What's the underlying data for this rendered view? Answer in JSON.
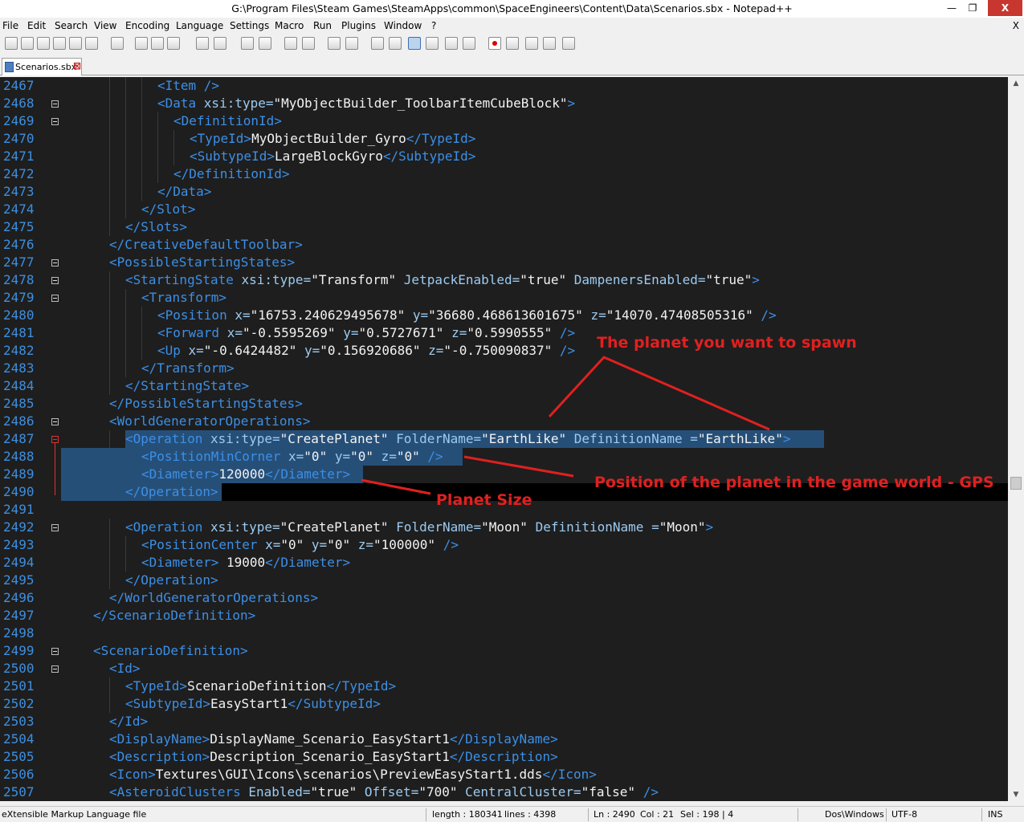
{
  "window": {
    "title": "G:\\Program Files\\Steam Games\\SteamApps\\common\\SpaceEngineers\\Content\\Data\\Scenarios.sbx - Notepad++",
    "min_glyph": "—",
    "max_glyph": "❐",
    "close_glyph": "X"
  },
  "menu": {
    "items": [
      "File",
      "Edit",
      "Search",
      "View",
      "Encoding",
      "Language",
      "Settings",
      "Macro",
      "Run",
      "Plugins",
      "Window",
      "?"
    ],
    "close_glyph": "X"
  },
  "toolbar": {
    "icons": [
      "new-file-icon",
      "open-file-icon",
      "save-icon",
      "save-all-icon",
      "close-icon",
      "close-all-icon",
      "print-icon",
      "cut-icon",
      "copy-icon",
      "paste-icon",
      "undo-icon",
      "redo-icon",
      "find-icon",
      "replace-icon",
      "zoom-in-icon",
      "zoom-out-icon",
      "sync-vertical-icon",
      "sync-horizontal-icon",
      "word-wrap-icon",
      "show-all-chars-icon",
      "indent-guide-icon",
      "user-language-icon",
      "doc-map-icon",
      "function-list-icon",
      "record-macro-icon",
      "stop-macro-icon",
      "play-macro-icon",
      "run-macro-multiple-icon",
      "save-macro-icon"
    ]
  },
  "tab": {
    "label": "Scenarios.sbx",
    "close_glyph": "⊠"
  },
  "editor": {
    "selection_color": "#264f78",
    "line_number_color": "#3d8fe0",
    "lines": [
      {
        "n": "2467",
        "fold": "",
        "indent": 4,
        "tokens": [
          [
            "tg",
            "<Item "
          ],
          [
            "pu",
            "/>"
          ]
        ]
      },
      {
        "n": "2468",
        "fold": "box",
        "indent": 4,
        "tokens": [
          [
            "tg",
            "<Data "
          ],
          [
            "an",
            "xsi:type="
          ],
          [
            "av",
            "\"MyObjectBuilder_ToolbarItemCubeBlock\""
          ],
          [
            "tg",
            ">"
          ]
        ]
      },
      {
        "n": "2469",
        "fold": "box",
        "indent": 5,
        "tokens": [
          [
            "tg",
            "<DefinitionId>"
          ]
        ]
      },
      {
        "n": "2470",
        "fold": "",
        "indent": 6,
        "tokens": [
          [
            "tg",
            "<TypeId>"
          ],
          [
            "tx",
            "MyObjectBuilder_Gyro"
          ],
          [
            "tg",
            "</TypeId>"
          ]
        ]
      },
      {
        "n": "2471",
        "fold": "",
        "indent": 6,
        "tokens": [
          [
            "tg",
            "<SubtypeId>"
          ],
          [
            "tx",
            "LargeBlockGyro"
          ],
          [
            "tg",
            "</SubtypeId>"
          ]
        ]
      },
      {
        "n": "2472",
        "fold": "",
        "indent": 5,
        "tokens": [
          [
            "tg",
            "</DefinitionId>"
          ]
        ]
      },
      {
        "n": "2473",
        "fold": "",
        "indent": 4,
        "tokens": [
          [
            "tg",
            "</Data>"
          ]
        ]
      },
      {
        "n": "2474",
        "fold": "",
        "indent": 3,
        "tokens": [
          [
            "tg",
            "</Slot>"
          ]
        ]
      },
      {
        "n": "2475",
        "fold": "",
        "indent": 2,
        "tokens": [
          [
            "tg",
            "</Slots>"
          ]
        ]
      },
      {
        "n": "2476",
        "fold": "",
        "indent": 1,
        "tokens": [
          [
            "tg",
            "</CreativeDefaultToolbar>"
          ]
        ]
      },
      {
        "n": "2477",
        "fold": "box",
        "indent": 1,
        "tokens": [
          [
            "tg",
            "<PossibleStartingStates>"
          ]
        ]
      },
      {
        "n": "2478",
        "fold": "box",
        "indent": 2,
        "tokens": [
          [
            "tg",
            "<StartingState "
          ],
          [
            "an",
            "xsi:type="
          ],
          [
            "av",
            "\"Transform\" "
          ],
          [
            "an",
            "JetpackEnabled="
          ],
          [
            "av",
            "\"true\" "
          ],
          [
            "an",
            "DampenersEnabled="
          ],
          [
            "av",
            "\"true\""
          ],
          [
            "tg",
            ">"
          ]
        ]
      },
      {
        "n": "2479",
        "fold": "box",
        "indent": 3,
        "tokens": [
          [
            "tg",
            "<Transform>"
          ]
        ]
      },
      {
        "n": "2480",
        "fold": "",
        "indent": 4,
        "tokens": [
          [
            "tg",
            "<Position "
          ],
          [
            "an",
            "x="
          ],
          [
            "av",
            "\"16753.240629495678\" "
          ],
          [
            "an",
            "y="
          ],
          [
            "av",
            "\"36680.468613601675\" "
          ],
          [
            "an",
            "z="
          ],
          [
            "av",
            "\"14070.47408505316\" "
          ],
          [
            "pu",
            "/>"
          ]
        ]
      },
      {
        "n": "2481",
        "fold": "",
        "indent": 4,
        "tokens": [
          [
            "tg",
            "<Forward "
          ],
          [
            "an",
            "x="
          ],
          [
            "av",
            "\"-0.5595269\" "
          ],
          [
            "an",
            "y="
          ],
          [
            "av",
            "\"0.5727671\" "
          ],
          [
            "an",
            "z="
          ],
          [
            "av",
            "\"0.5990555\" "
          ],
          [
            "pu",
            "/>"
          ]
        ]
      },
      {
        "n": "2482",
        "fold": "",
        "indent": 4,
        "tokens": [
          [
            "tg",
            "<Up "
          ],
          [
            "an",
            "x="
          ],
          [
            "av",
            "\"-0.6424482\" "
          ],
          [
            "an",
            "y="
          ],
          [
            "av",
            "\"0.156920686\" "
          ],
          [
            "an",
            "z="
          ],
          [
            "av",
            "\"-0.750090837\" "
          ],
          [
            "pu",
            "/>"
          ]
        ]
      },
      {
        "n": "2483",
        "fold": "",
        "indent": 3,
        "tokens": [
          [
            "tg",
            "</Transform>"
          ]
        ]
      },
      {
        "n": "2484",
        "fold": "",
        "indent": 2,
        "tokens": [
          [
            "tg",
            "</StartingState>"
          ]
        ]
      },
      {
        "n": "2485",
        "fold": "",
        "indent": 1,
        "tokens": [
          [
            "tg",
            "</PossibleStartingStates>"
          ]
        ]
      },
      {
        "n": "2486",
        "fold": "box",
        "indent": 1,
        "tokens": [
          [
            "tg",
            "<WorldGeneratorOperations>"
          ]
        ]
      },
      {
        "n": "2487",
        "fold": "red",
        "indent": 2,
        "tokens": [
          [
            "tg",
            "<Operation "
          ],
          [
            "an",
            "xsi:type="
          ],
          [
            "av",
            "\"CreatePlanet\" "
          ],
          [
            "an",
            "FolderName="
          ],
          [
            "av",
            "\"EarthLike\" "
          ],
          [
            "an",
            "DefinitionName ="
          ],
          [
            "av",
            "\"EarthLike\""
          ],
          [
            "tg",
            ">"
          ]
        ]
      },
      {
        "n": "2488",
        "fold": "",
        "indent": 3,
        "tokens": [
          [
            "tg",
            "<PositionMinCorner "
          ],
          [
            "an",
            "x="
          ],
          [
            "av",
            "\"0\" "
          ],
          [
            "an",
            "y="
          ],
          [
            "av",
            "\"0\" "
          ],
          [
            "an",
            "z="
          ],
          [
            "av",
            "\"0\" "
          ],
          [
            "pu",
            "/>"
          ]
        ]
      },
      {
        "n": "2489",
        "fold": "",
        "indent": 3,
        "tokens": [
          [
            "tg",
            "<Diameter>"
          ],
          [
            "tx",
            "120000"
          ],
          [
            "tg",
            "</Diameter>"
          ]
        ]
      },
      {
        "n": "2490",
        "fold": "",
        "indent": 2,
        "tokens": [
          [
            "tg",
            "</Operation>"
          ]
        ]
      },
      {
        "n": "2491",
        "fold": "",
        "indent": 0,
        "tokens": []
      },
      {
        "n": "2492",
        "fold": "box",
        "indent": 2,
        "tokens": [
          [
            "tg",
            "<Operation "
          ],
          [
            "an",
            "xsi:type="
          ],
          [
            "av",
            "\"CreatePlanet\" "
          ],
          [
            "an",
            "FolderName="
          ],
          [
            "av",
            "\"Moon\" "
          ],
          [
            "an",
            "DefinitionName ="
          ],
          [
            "av",
            "\"Moon\""
          ],
          [
            "tg",
            ">"
          ]
        ]
      },
      {
        "n": "2493",
        "fold": "",
        "indent": 3,
        "tokens": [
          [
            "tg",
            "<PositionCenter "
          ],
          [
            "an",
            "x="
          ],
          [
            "av",
            "\"0\" "
          ],
          [
            "an",
            "y="
          ],
          [
            "av",
            "\"0\" "
          ],
          [
            "an",
            "z="
          ],
          [
            "av",
            "\"100000\" "
          ],
          [
            "pu",
            "/>"
          ]
        ]
      },
      {
        "n": "2494",
        "fold": "",
        "indent": 3,
        "tokens": [
          [
            "tg",
            "<Diameter> "
          ],
          [
            "tx",
            "19000"
          ],
          [
            "tg",
            "</Diameter>"
          ]
        ]
      },
      {
        "n": "2495",
        "fold": "",
        "indent": 2,
        "tokens": [
          [
            "tg",
            "</Operation>"
          ]
        ]
      },
      {
        "n": "2496",
        "fold": "",
        "indent": 1,
        "tokens": [
          [
            "tg",
            "</WorldGeneratorOperations>"
          ]
        ]
      },
      {
        "n": "2497",
        "fold": "",
        "indent": 0,
        "tokens": [
          [
            "tg",
            "</ScenarioDefinition>"
          ]
        ]
      },
      {
        "n": "2498",
        "fold": "",
        "indent": 0,
        "tokens": []
      },
      {
        "n": "2499",
        "fold": "box",
        "indent": 0,
        "tokens": [
          [
            "tg",
            "<ScenarioDefinition>"
          ]
        ]
      },
      {
        "n": "2500",
        "fold": "box",
        "indent": 1,
        "tokens": [
          [
            "tg",
            "<Id>"
          ]
        ]
      },
      {
        "n": "2501",
        "fold": "",
        "indent": 2,
        "tokens": [
          [
            "tg",
            "<TypeId>"
          ],
          [
            "tx",
            "ScenarioDefinition"
          ],
          [
            "tg",
            "</TypeId>"
          ]
        ]
      },
      {
        "n": "2502",
        "fold": "",
        "indent": 2,
        "tokens": [
          [
            "tg",
            "<SubtypeId>"
          ],
          [
            "tx",
            "EasyStart1"
          ],
          [
            "tg",
            "</SubtypeId>"
          ]
        ]
      },
      {
        "n": "2503",
        "fold": "",
        "indent": 1,
        "tokens": [
          [
            "tg",
            "</Id>"
          ]
        ]
      },
      {
        "n": "2504",
        "fold": "",
        "indent": 1,
        "tokens": [
          [
            "tg",
            "<DisplayName>"
          ],
          [
            "tx",
            "DisplayName_Scenario_EasyStart1"
          ],
          [
            "tg",
            "</DisplayName>"
          ]
        ]
      },
      {
        "n": "2505",
        "fold": "",
        "indent": 1,
        "tokens": [
          [
            "tg",
            "<Description>"
          ],
          [
            "tx",
            "Description_Scenario_EasyStart1"
          ],
          [
            "tg",
            "</Description>"
          ]
        ]
      },
      {
        "n": "2506",
        "fold": "",
        "indent": 1,
        "tokens": [
          [
            "tg",
            "<Icon>"
          ],
          [
            "tx",
            "Textures\\GUI\\Icons\\scenarios\\PreviewEasyStart1.dds"
          ],
          [
            "tg",
            "</Icon>"
          ]
        ]
      },
      {
        "n": "2507",
        "fold": "",
        "indent": 1,
        "tokens": [
          [
            "tg",
            "<AsteroidClusters "
          ],
          [
            "an",
            "Enabled="
          ],
          [
            "av",
            "\"true\" "
          ],
          [
            "an",
            "Offset="
          ],
          [
            "av",
            "\"700\" "
          ],
          [
            "an",
            "CentralCluster="
          ],
          [
            "av",
            "\"false\" "
          ],
          [
            "pu",
            "/>"
          ]
        ]
      }
    ]
  },
  "annotations": {
    "color": "#e02020",
    "planet_spawn": "The planet you want to spawn",
    "position": "Position of the planet in the game world - GPS",
    "size": "Planet Size"
  },
  "status": {
    "filetype": "eXtensible Markup Language file",
    "length": "length : 180341",
    "lines": "lines : 4398",
    "ln": "Ln : 2490",
    "col": "Col : 21",
    "sel": "Sel : 198 | 4",
    "eol": "Dos\\Windows",
    "encoding": "UTF-8",
    "mode": "INS"
  }
}
